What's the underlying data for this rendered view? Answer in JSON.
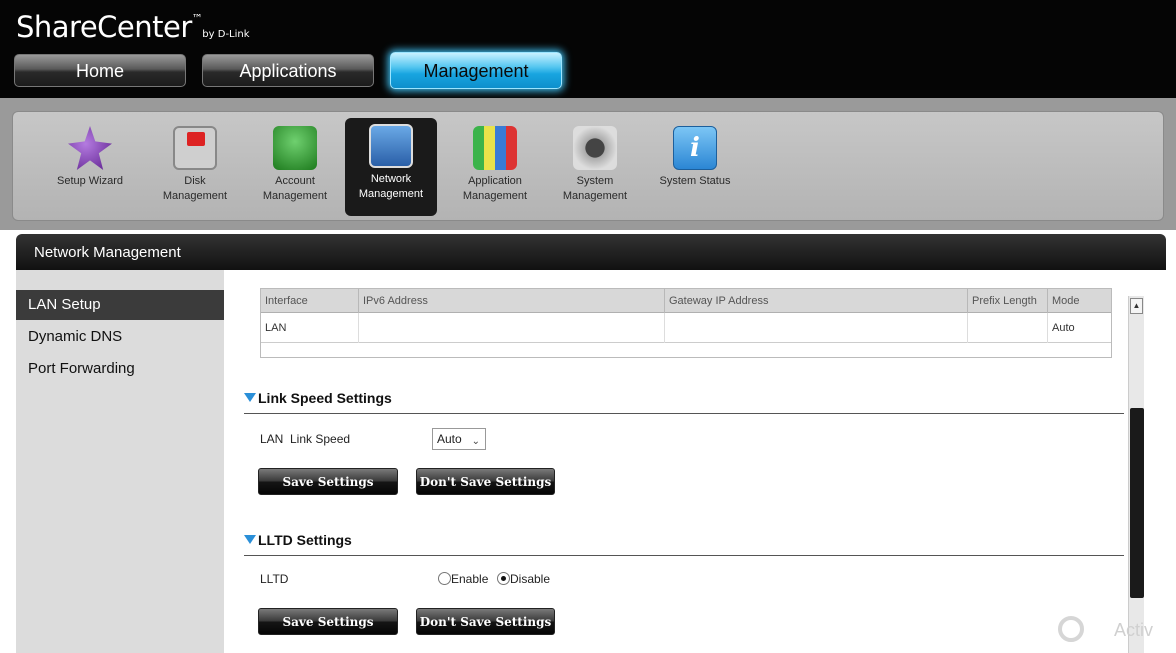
{
  "brand": {
    "name": "ShareCenter",
    "tm": "™",
    "by": "by D-Link"
  },
  "nav": {
    "home": "Home",
    "applications": "Applications",
    "management": "Management"
  },
  "toolbar": [
    {
      "key": "setup",
      "label": "Setup Wizard",
      "icon": "wizard-icon"
    },
    {
      "key": "disk",
      "label_1": "Disk",
      "label_2": "Management",
      "icon": "disk-management-icon"
    },
    {
      "key": "account",
      "label_1": "Account",
      "label_2": "Management",
      "icon": "account-management-icon"
    },
    {
      "key": "network",
      "label_1": "Network",
      "label_2": "Management",
      "icon": "network-management-icon",
      "active": true
    },
    {
      "key": "application",
      "label_1": "Application",
      "label_2": "Management",
      "icon": "application-management-icon"
    },
    {
      "key": "system",
      "label_1": "System",
      "label_2": "Management",
      "icon": "system-management-icon"
    },
    {
      "key": "status",
      "label": "System Status",
      "icon": "system-status-icon",
      "glyph": "i"
    }
  ],
  "section": {
    "title": "Network Management"
  },
  "sidebar": {
    "items": [
      "LAN Setup",
      "Dynamic DNS",
      "Port Forwarding"
    ],
    "active": "LAN Setup"
  },
  "ipv6_table": {
    "headers": [
      "Interface",
      "IPv6 Address",
      "Gateway IP Address",
      "Prefix Length",
      "Mode"
    ],
    "rows": [
      [
        "LAN",
        "",
        "",
        "",
        "Auto"
      ]
    ]
  },
  "link_speed": {
    "title": "Link Speed Settings",
    "label": "LAN  Link Speed",
    "value": "Auto",
    "save": "Save Settings",
    "dont_save": "Don't Save Settings"
  },
  "lltd": {
    "title": "LLTD Settings",
    "label": "LLTD",
    "enable": "Enable",
    "disable": "Disable",
    "selected": "Disable",
    "save": "Save Settings",
    "dont_save": "Don't Save Settings"
  },
  "watermark": {
    "text": "Activ"
  },
  "colors": {
    "accent": "#18a5e0",
    "header_bg": "#050505",
    "triangle": "#2a8fd8"
  }
}
